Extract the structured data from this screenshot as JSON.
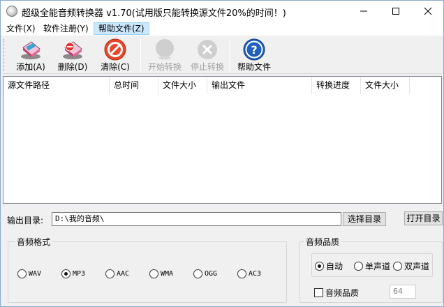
{
  "window": {
    "title": "超级全能音频转换器 v1.70(试用版只能转换源文件20%的时间！)"
  },
  "menu": {
    "items": [
      {
        "label": "文件(X)"
      },
      {
        "label": "软件注册(Y)"
      },
      {
        "label": "帮助文件(Z)"
      }
    ]
  },
  "toolbar": {
    "add": "添加(A)",
    "delete": "删除(D)",
    "clear": "清除(C)",
    "start": "开始转换",
    "stop": "停止转换",
    "help": "帮助文件"
  },
  "list": {
    "columns": [
      "源文件路径",
      "总时间",
      "文件大小",
      "输出文件",
      "转换进度",
      "文件大小"
    ]
  },
  "output": {
    "label": "输出目录:",
    "value": "D:\\我的音频\\",
    "choose_button": "选择目录",
    "open_button": "打开目录"
  },
  "format": {
    "title": "音频格式",
    "options": [
      "WAV",
      "MP3",
      "AAC",
      "WMA",
      "OGG",
      "AC3"
    ],
    "selected": "MP3"
  },
  "quality": {
    "title": "音频品质",
    "channels": [
      "自动",
      "单声道",
      "双声道"
    ],
    "selected": "自动",
    "checkbox_label": "音频品质",
    "checked": false,
    "value": "64"
  }
}
